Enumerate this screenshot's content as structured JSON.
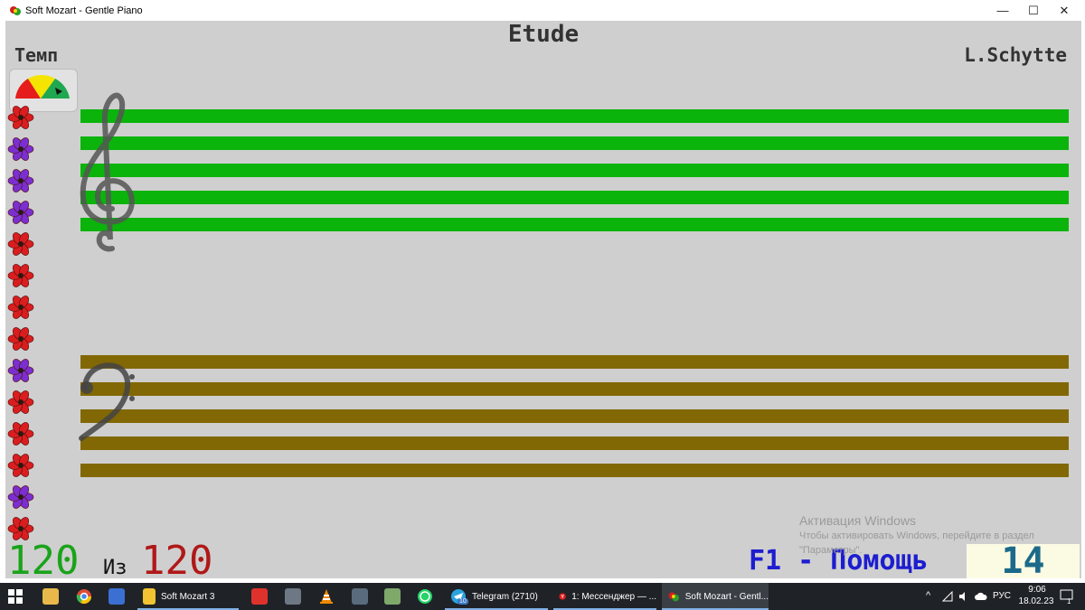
{
  "window": {
    "title": "Soft Mozart - Gentle Piano",
    "minimize_glyph": "—",
    "maximize_glyph": "☐",
    "close_glyph": "✕"
  },
  "score": {
    "title": "Etude",
    "composer": "L.Schytte",
    "tempo_label": "Темп",
    "treble_color": "#0bb40b",
    "bass_color": "#826804"
  },
  "flowers": [
    "red",
    "purple",
    "purple",
    "purple",
    "red",
    "red",
    "red",
    "red",
    "purple",
    "red",
    "red",
    "red",
    "purple",
    "red"
  ],
  "flower_colors": {
    "red": "#d81e1e",
    "purple": "#7a2fd0"
  },
  "progress": {
    "current": "120",
    "of_label": "Из",
    "total": "120"
  },
  "help": {
    "label": "F1 - Помощь"
  },
  "score_counter": "14",
  "activation": {
    "heading": "Активация Windows",
    "line1": "Чтобы активировать Windows, перейдите в раздел",
    "line2": "\"Параметры\"."
  },
  "taskbar": {
    "pinned": [
      {
        "name": "explorer-folder",
        "label": "Soft Mozart 3"
      },
      {
        "name": "telegram",
        "label": "Telegram (2710)"
      },
      {
        "name": "yandex-messenger",
        "label": "1: Мессенджер — ..."
      },
      {
        "name": "soft-mozart",
        "label": "Soft Mozart - Gentl..."
      }
    ],
    "telegram_badge": "10",
    "language": "РУС",
    "time": "9:06",
    "date": "18.02.23",
    "notif_count": "1"
  }
}
